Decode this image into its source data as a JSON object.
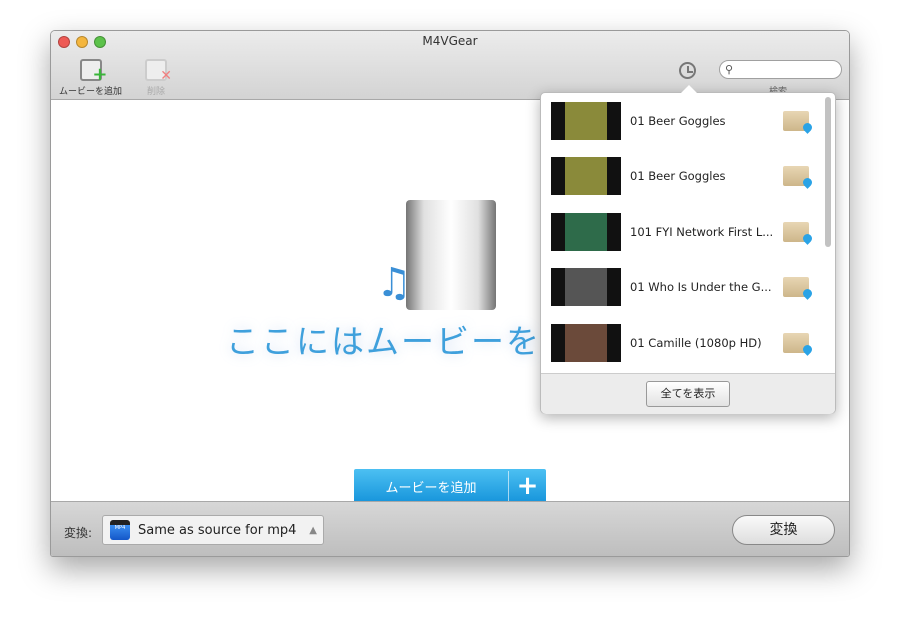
{
  "window": {
    "title": "M4VGear"
  },
  "toolbar": {
    "add_movie": "ムービーを追加",
    "delete": "削除",
    "search_label": "検索",
    "search_placeholder": ""
  },
  "main": {
    "drop_text": "ここにはムービーを",
    "add_button": "ムービーを追加"
  },
  "bottom": {
    "convert_label": "変換:",
    "format": "Same as source for mp4",
    "format_icon": "MP4",
    "convert_button": "変換"
  },
  "history": {
    "items": [
      {
        "title": "01 Beer Goggles",
        "thumb": "#8a8a3a"
      },
      {
        "title": "01 Beer Goggles",
        "thumb": "#8a8a3a"
      },
      {
        "title": "101 FYI Network First L...",
        "thumb": "#2e6b4a"
      },
      {
        "title": "01 Who Is Under the G...",
        "thumb": "#555"
      },
      {
        "title": "01 Camille (1080p HD)",
        "thumb": "#6b4a3a"
      }
    ],
    "show_all": "全てを表示"
  }
}
